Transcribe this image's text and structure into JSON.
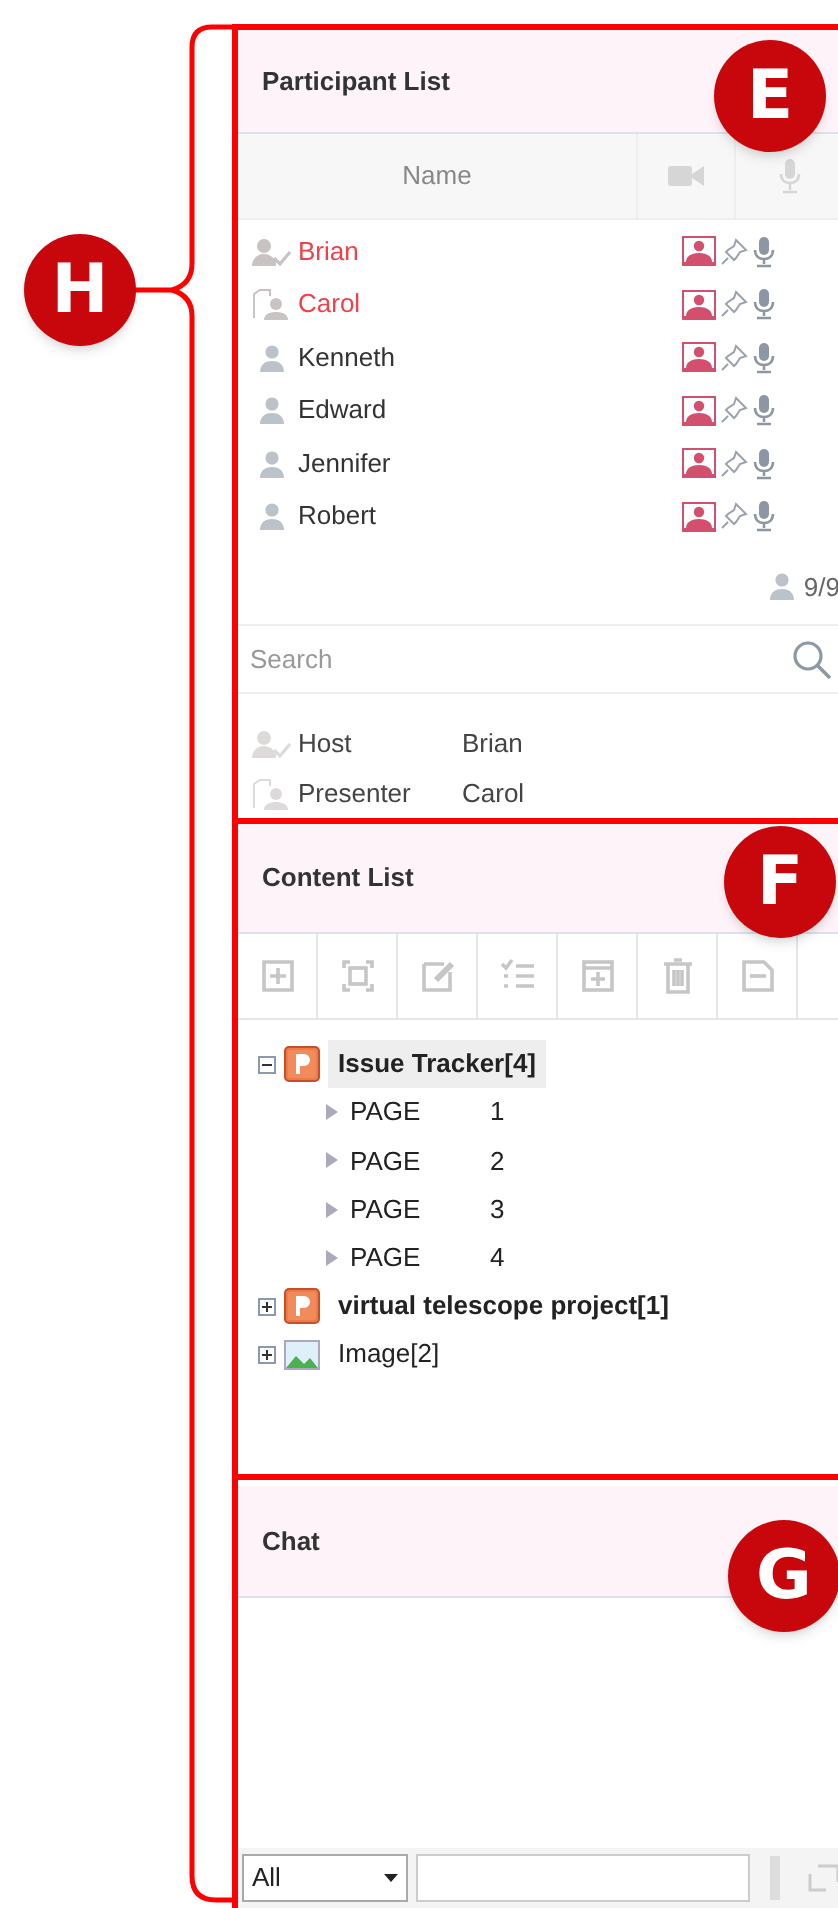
{
  "participant_panel": {
    "title": "Participant List",
    "columns": [
      "Name"
    ],
    "participants": [
      {
        "name": "Brian",
        "kind": "host"
      },
      {
        "name": "Carol",
        "kind": "presenter"
      },
      {
        "name": "Kenneth",
        "kind": "member"
      },
      {
        "name": "Edward",
        "kind": "member"
      },
      {
        "name": "Jennifer",
        "kind": "member"
      },
      {
        "name": "Robert",
        "kind": "member"
      }
    ],
    "count": "9/9",
    "search": {
      "placeholder": "Search"
    },
    "roles": [
      {
        "kind": "host",
        "label": "Host",
        "name": "Brian"
      },
      {
        "kind": "presenter",
        "label": "Presenter",
        "name": "Carol"
      }
    ]
  },
  "content_panel": {
    "title": "Content List",
    "tree": [
      {
        "kind": "presentation",
        "label": "Issue Tracker[4]",
        "expanded": true,
        "selected": true,
        "children": [
          {
            "label": "PAGE",
            "number": "1"
          },
          {
            "label": "PAGE",
            "number": "2"
          },
          {
            "label": "PAGE",
            "number": "3"
          },
          {
            "label": "PAGE",
            "number": "4"
          }
        ]
      },
      {
        "kind": "presentation",
        "label": "virtual telescope project[1]",
        "expanded": false,
        "selected": false
      },
      {
        "kind": "image",
        "label": "Image[2]",
        "expanded": false,
        "selected": false
      }
    ]
  },
  "chat_panel": {
    "title": "Chat",
    "recipient": "All"
  },
  "callouts": [
    {
      "label": "H"
    },
    {
      "label": "E"
    },
    {
      "label": "F"
    },
    {
      "label": "G"
    }
  ]
}
